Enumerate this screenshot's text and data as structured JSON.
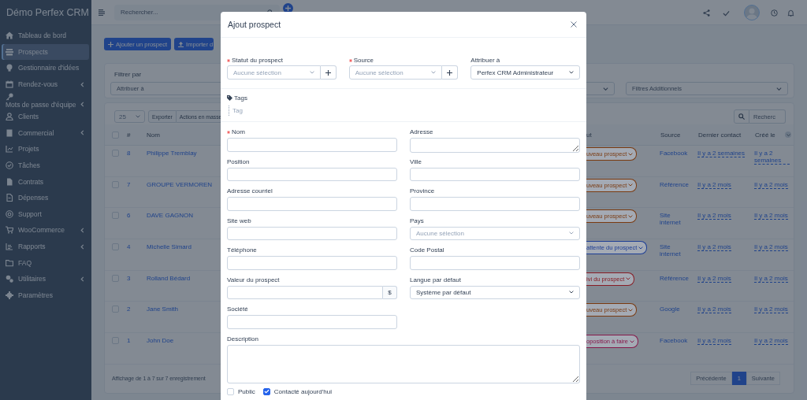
{
  "sidebar": {
    "brand": "Démo Perfex CRM",
    "items": [
      {
        "label": "Tableau de bord",
        "selected": false,
        "has_submenu": false
      },
      {
        "label": "Prospects",
        "selected": true,
        "has_submenu": false
      },
      {
        "label": "Gestionnaire d'idées",
        "selected": false,
        "has_submenu": false
      },
      {
        "label": "Rendez-vous",
        "selected": false,
        "has_submenu": true
      },
      {
        "label": "Mots de passe d'équipe",
        "selected": false,
        "has_submenu": true
      },
      {
        "label": "Clients",
        "selected": false,
        "has_submenu": false
      },
      {
        "label": "Commercial",
        "selected": false,
        "has_submenu": true
      },
      {
        "label": "Projets",
        "selected": false,
        "has_submenu": false
      },
      {
        "label": "Tâches",
        "selected": false,
        "has_submenu": false
      },
      {
        "label": "Contrats",
        "selected": false,
        "has_submenu": false
      },
      {
        "label": "Dépenses",
        "selected": false,
        "has_submenu": false
      },
      {
        "label": "Support",
        "selected": false,
        "has_submenu": false
      },
      {
        "label": "WooCommerce",
        "selected": false,
        "has_submenu": true
      },
      {
        "label": "Rapports",
        "selected": false,
        "has_submenu": true
      },
      {
        "label": "FAQ",
        "selected": false,
        "has_submenu": false
      },
      {
        "label": "Utilitaires",
        "selected": false,
        "has_submenu": true
      },
      {
        "label": "Paramètres",
        "selected": false,
        "has_submenu": false
      }
    ]
  },
  "topbar": {
    "search_placeholder": "Rechercher..."
  },
  "page": {
    "buttons": [
      "Ajouter un prospect",
      "Importer d"
    ],
    "filter": {
      "title": "Filtrer par",
      "selects": [
        "Attribuer à",
        "Filtres Additionnels"
      ]
    },
    "table": {
      "all_selected": false,
      "page_size": "25",
      "tools": [
        "Exporter",
        "Actions en masse"
      ],
      "search_placeholder": "Recherc",
      "columns": [
        "#",
        "Nom",
        "ut",
        "Source",
        "Dernier contact",
        "Créé le"
      ],
      "rows": [
        {
          "selected": false,
          "id": "8",
          "name": "Philippe Tremblay",
          "status": "uveau prospect",
          "color": "#7a3a10",
          "source": "Facebook",
          "last_contact": "Il y a 2 semaines",
          "created": "Il y a 2 semaines"
        },
        {
          "selected": false,
          "id": "7",
          "name": "GROUPE VERMOREN",
          "status": "uveau prospect",
          "color": "#7a3a10",
          "source": "Référence",
          "last_contact": "Il y a 2 mois",
          "created": "Il y a 2 mois"
        },
        {
          "selected": false,
          "id": "6",
          "name": "DAVE GAGNON",
          "status": "uveau prospect",
          "color": "#7a3a10",
          "source": "Site internet",
          "last_contact": "Il y a 2 mois",
          "created": "Il y a 2 mois"
        },
        {
          "selected": false,
          "id": "4",
          "name": "Michelle Simard",
          "status": "attente du prospect",
          "color": "#1c3d94",
          "source": "Site internet",
          "last_contact": "Il y a 2 mois",
          "created": "Il y a 2 mois"
        },
        {
          "selected": false,
          "id": "3",
          "name": "Rolland Bédard",
          "status": "ivi du prospect",
          "color": "#881c24",
          "source": "Référence",
          "last_contact": "Il y a 2 mois",
          "created": "Il y a 2 mois"
        },
        {
          "selected": false,
          "id": "2",
          "name": "Jane Smith",
          "status": "uveau prospect",
          "color": "#7a3a10",
          "source": "Google",
          "last_contact": "Il y a 2 mois",
          "created": "Il y a 2 mois"
        },
        {
          "selected": false,
          "id": "1",
          "name": "John Doe",
          "status": "oposition à faire",
          "color": "#86184a",
          "source": "Facebook",
          "last_contact": "Il y a 2 mois",
          "created": "Il y a 2 mois"
        }
      ],
      "info": "Affichage de 1 à 7 sur 7 enregistrement",
      "pagination": [
        {
          "label": "Précédente",
          "selected": false
        },
        {
          "label": "1",
          "selected": true
        },
        {
          "label": "Suivante",
          "selected": false
        }
      ]
    }
  },
  "modal": {
    "title": "Ajout prospect",
    "top_fields": [
      {
        "label": "Statut du prospect",
        "required": true,
        "placeholder": "Aucune sélection",
        "add_button": true
      },
      {
        "label": "Source",
        "required": true,
        "placeholder": "Aucune sélection",
        "add_button": true
      },
      {
        "label": "Attribuer à",
        "required": false,
        "value": "Perfex CRM Administrateur",
        "add_button": false
      }
    ],
    "tags": {
      "label": "Tags",
      "placeholder": "Tag"
    },
    "left_fields": [
      {
        "label": "Nom",
        "required": true,
        "kind": "input"
      },
      {
        "label": "Position",
        "required": false,
        "kind": "input"
      },
      {
        "label": "Adresse courriel",
        "required": false,
        "kind": "input"
      },
      {
        "label": "Site web",
        "required": false,
        "kind": "input"
      },
      {
        "label": "Téléphone",
        "required": false,
        "kind": "input"
      },
      {
        "label": "Valeur du prospect",
        "required": false,
        "kind": "addon",
        "addon": "$"
      },
      {
        "label": "Société",
        "required": false,
        "kind": "input"
      }
    ],
    "right_fields": [
      {
        "label": "Adresse",
        "required": false,
        "kind": "textarea"
      },
      {
        "label": "Ville",
        "required": false,
        "kind": "input"
      },
      {
        "label": "Province",
        "required": false,
        "kind": "input"
      },
      {
        "label": "Pays",
        "required": false,
        "kind": "select",
        "placeholder": "Aucune sélection"
      },
      {
        "label": "Code Postal",
        "required": false,
        "kind": "input"
      },
      {
        "label": "Langue par défaut",
        "required": false,
        "kind": "select",
        "value": "Système par défaut"
      }
    ],
    "description": {
      "label": "Description"
    },
    "checkboxes": [
      {
        "label": "Public",
        "checked": false
      },
      {
        "label": "Contacté aujourd'hui",
        "checked": true
      }
    ]
  }
}
